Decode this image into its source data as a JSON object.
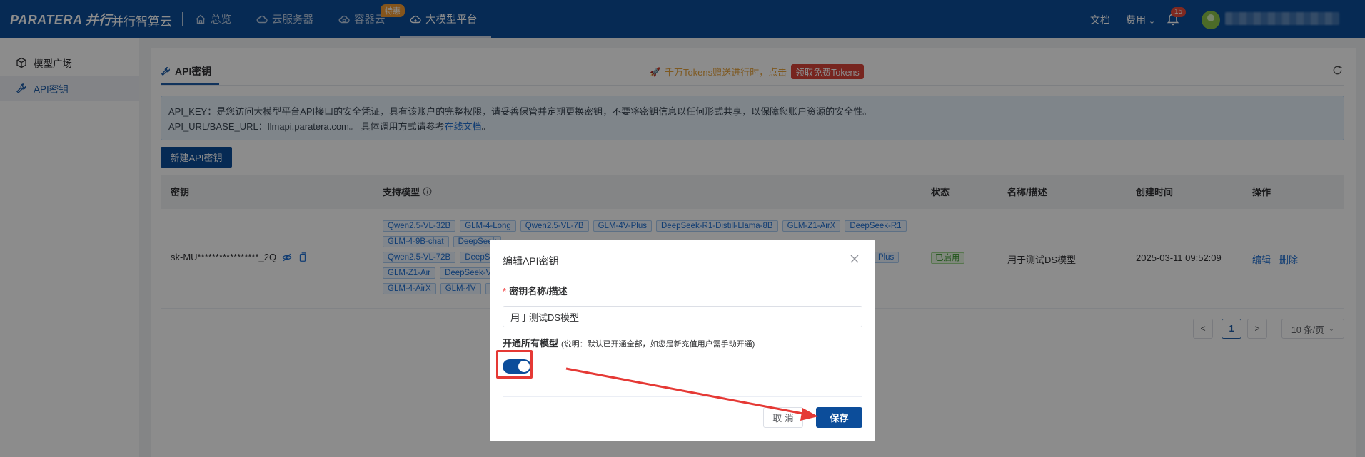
{
  "topnav": {
    "logo_text": "PARATERA",
    "logo_cn": "并行",
    "product": "并行智算云",
    "items": [
      {
        "label": "总览",
        "icon": "home-icon"
      },
      {
        "label": "云服务器",
        "icon": "cloud-server-icon"
      },
      {
        "label": "容器云",
        "icon": "container-cloud-icon",
        "badge": "特惠"
      },
      {
        "label": "大模型平台",
        "icon": "model-platform-icon",
        "active": true
      }
    ],
    "docs": "文档",
    "billing": "费用",
    "notification_count": "15"
  },
  "sidebar": {
    "items": [
      {
        "label": "模型广场",
        "icon": "cube-icon"
      },
      {
        "label": "API密钥",
        "icon": "wrench-icon",
        "active": true
      }
    ]
  },
  "page": {
    "tab_title": "API密钥",
    "promo_text": "千万Tokens赠送进行时，点击",
    "promo_button": "领取免费Tokens",
    "info_line1": "API_KEY：是您访问大模型平台API接口的安全凭证，具有该账户的完整权限，请妥善保管并定期更换密钥，不要将密钥信息以任何形式共享，以保障您账户资源的安全性。",
    "info_line2_prefix": "API_URL/BASE_URL：llmapi.paratera.com。 具体调用方式请参考",
    "info_line2_link": "在线文档",
    "info_line2_suffix": "。",
    "new_key_button": "新建API密钥"
  },
  "table": {
    "headers": {
      "key": "密钥",
      "models": "支持模型",
      "status": "状态",
      "name": "名称/描述",
      "created": "创建时间",
      "ops": "操作"
    },
    "row": {
      "key": "sk-MU*****************_2Q",
      "model_rows": [
        [
          "Qwen2.5-VL-32B",
          "GLM-4-Long",
          "Qwen2.5-VL-7B",
          "GLM-4V-Plus",
          "DeepSeek-R1-Distill-Llama-8B",
          "GLM-Z1-AirX",
          "DeepSeek-R1"
        ],
        [
          "GLM-4-9B-chat",
          "DeepSeek"
        ],
        [
          "Qwen2.5-VL-72B",
          "DeepSeek",
          "Plus"
        ],
        [
          "GLM-Z1-Air",
          "DeepSeek-V3"
        ],
        [
          "GLM-4-AirX",
          "GLM-4V",
          "D"
        ]
      ],
      "status": "已启用",
      "name": "用于测试DS模型",
      "created": "2025-03-11 09:52:09",
      "edit": "编辑",
      "delete": "删除"
    }
  },
  "pagination": {
    "prev": "<",
    "current": "1",
    "next": ">",
    "page_size": "10 条/页"
  },
  "modal": {
    "title": "编辑API密钥",
    "name_label": "密钥名称/描述",
    "required_mark": "*",
    "name_value": "用于测试DS模型",
    "switch_label": "开通所有模型",
    "switch_hint": "(说明：默认已开通全部，如您是新充值用户需手动开通)",
    "switch_on": true,
    "cancel": "取 消",
    "save": "保存"
  }
}
